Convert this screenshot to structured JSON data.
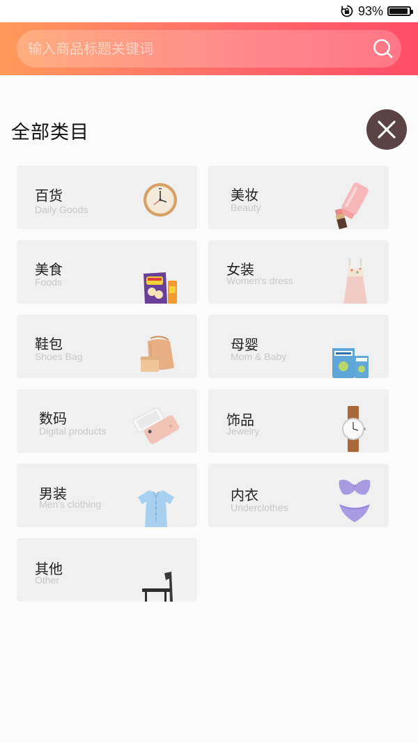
{
  "status_bar": {
    "battery_percent": "93%",
    "battery_level": 0.93
  },
  "search": {
    "placeholder": "输入商品标题关键词",
    "value": ""
  },
  "page_title": "全部类目",
  "categories": [
    {
      "cn": "百货",
      "en": "Daily Goods",
      "icon": "clock-icon"
    },
    {
      "cn": "美妆",
      "en": "Beauty",
      "icon": "lipstick-icon"
    },
    {
      "cn": "美食",
      "en": "Foods",
      "icon": "snack-bag-icon"
    },
    {
      "cn": "女装",
      "en": "Women's dress",
      "icon": "dress-icon"
    },
    {
      "cn": "鞋包",
      "en": "Shoes Bag",
      "icon": "handbag-icon"
    },
    {
      "cn": "母婴",
      "en": "Mom & Baby",
      "icon": "milk-powder-icon"
    },
    {
      "cn": "数码",
      "en": "Digital products",
      "icon": "smartphone-icon"
    },
    {
      "cn": "饰品",
      "en": "Jewelry",
      "icon": "wristwatch-icon"
    },
    {
      "cn": "男装",
      "en": "Men's clothing",
      "icon": "shirt-icon"
    },
    {
      "cn": "内衣",
      "en": "Underclothes",
      "icon": "bikini-icon"
    },
    {
      "cn": "其他",
      "en": "Other",
      "icon": "chair-icon"
    }
  ],
  "colors": {
    "header_start": "#ff9a5a",
    "header_end": "#ff4d66",
    "close_button": "#5b4244",
    "card_bg": "#f0f0f0"
  }
}
